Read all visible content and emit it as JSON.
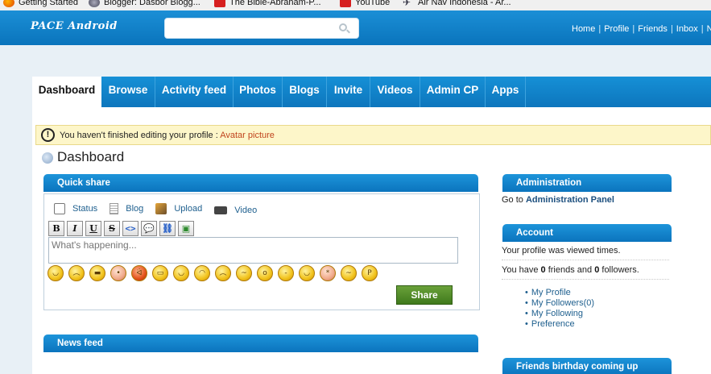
{
  "bookmarks": [
    "Getting Started",
    "Blogger: Dasbor Blogg...",
    "The Bible-Abraham-P...",
    "YouTube",
    "Air Nav Indonesia - Ar..."
  ],
  "header": {
    "logo": "PACE Android",
    "search_placeholder": "",
    "links": [
      "Home",
      "Profile",
      "Friends",
      "Inbox",
      "No"
    ]
  },
  "nav": {
    "tabs": [
      "Dashboard",
      "Browse",
      "Activity feed",
      "Photos",
      "Blogs",
      "Invite",
      "Videos",
      "Admin CP",
      "Apps"
    ],
    "active": "Dashboard"
  },
  "notice": {
    "icon": "!",
    "message": "You haven't finished editing your profile : ",
    "link": "Avatar picture"
  },
  "page_title": "Dashboard",
  "quick_share": {
    "title": "Quick share",
    "types": [
      "Status",
      "Blog",
      "Upload",
      "Video"
    ],
    "format_buttons": [
      "B",
      "I",
      "U",
      "S",
      "<>",
      "💬",
      "⛓",
      "▣"
    ],
    "placeholder": "What's happening...",
    "share_label": "Share"
  },
  "news_feed": {
    "title": "News feed"
  },
  "sidebar": {
    "administration": {
      "title": "Administration",
      "prefix": "Go to ",
      "link": "Administration Panel"
    },
    "account": {
      "title": "Account",
      "viewed": "Your profile was viewed times.",
      "friends_pre": "You have ",
      "friends_count": "0",
      "friends_mid": " friends and ",
      "followers_count": "0",
      "followers_post": " followers.",
      "links": [
        "My Profile",
        "My Followers(0)",
        "My Following",
        "Preference"
      ]
    },
    "birthday": {
      "title": "Friends birthday coming up"
    }
  }
}
